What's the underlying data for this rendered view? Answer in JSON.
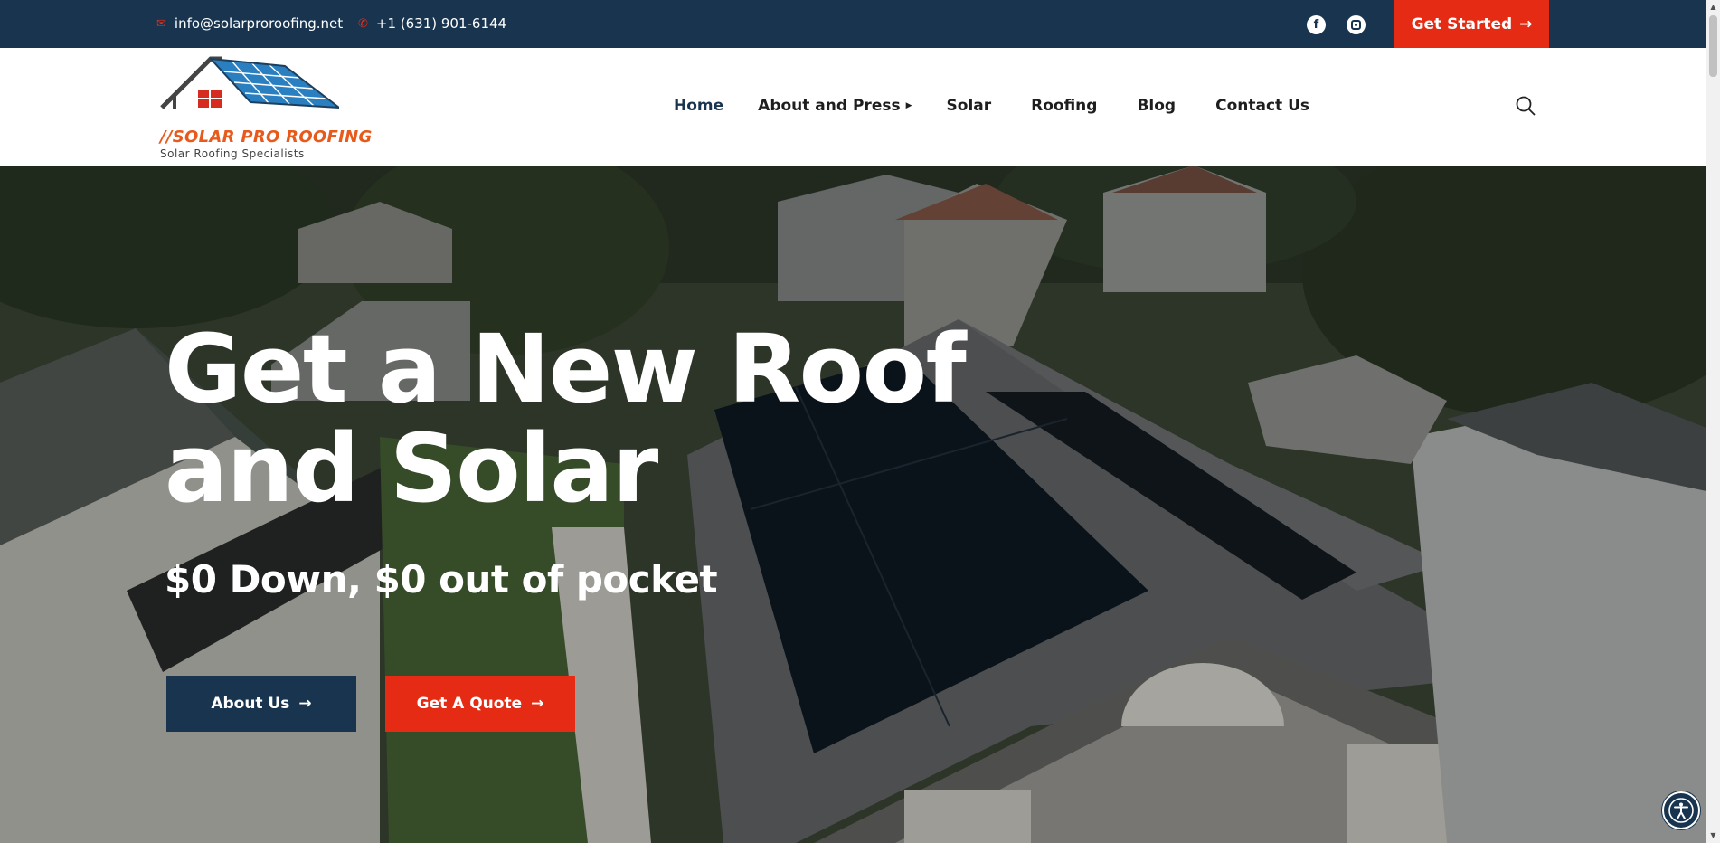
{
  "topbar": {
    "email": "info@solarproroofing.net",
    "phone": "+1 (631) 901-6144",
    "cta_label": "Get Started",
    "icons": [
      "envelope-icon",
      "phone-icon",
      "facebook-icon",
      "instagram-icon",
      "arrow-right-icon"
    ]
  },
  "header": {
    "brand_name": "//SOLAR PRO ROOFING",
    "brand_tagline": "Solar Roofing Specialists",
    "nav": [
      {
        "label": "Home",
        "active": true
      },
      {
        "label": "About and Press",
        "has_submenu": true
      },
      {
        "label": "Solar"
      },
      {
        "label": "Roofing"
      },
      {
        "label": "Blog"
      },
      {
        "label": "Contact Us"
      }
    ]
  },
  "hero": {
    "headline_line1": "Get a New Roof",
    "headline_line2": "and Solar",
    "subheadline": "$0 Down, $0 out of pocket",
    "primary_button": "About Us",
    "secondary_button": "Get A Quote"
  },
  "colors": {
    "navy": "#18344f",
    "accent_red": "#e52b13",
    "brand_orange": "#e85a1b",
    "white": "#ffffff"
  }
}
